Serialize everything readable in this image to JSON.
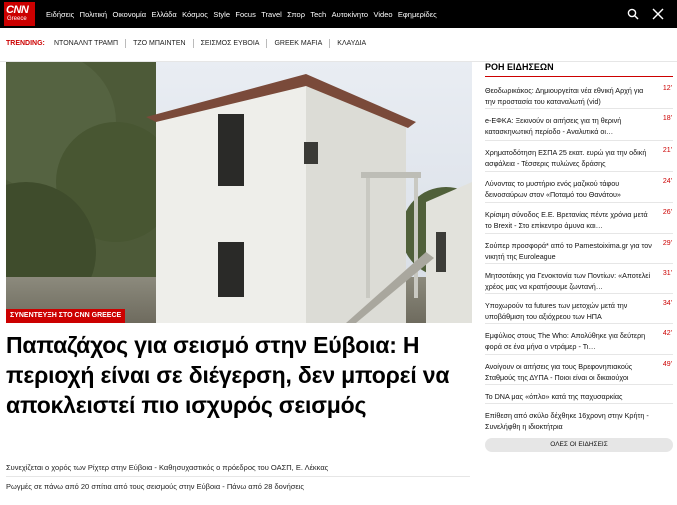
{
  "brand": {
    "logo_main": "CNN",
    "logo_sub": "Greece"
  },
  "nav": {
    "items": [
      "Ειδήσεις",
      "Πολιτική",
      "Οικονομία",
      "Ελλάδα",
      "Κόσμος",
      "Style",
      "Focus",
      "Travel",
      "Σπορ",
      "Tech",
      "Αυτοκίνητο",
      "Video",
      "Εφημερίδες"
    ]
  },
  "icons": {
    "search": "search-icon",
    "menu": "hamburger-menu-icon"
  },
  "trending": {
    "label": "TRENDING:",
    "items": [
      "ΝΤΟΝΑΛΝΤ ΤΡΑΜΠ",
      "ΤΖΟ ΜΠΑΙΝΤΕΝ",
      "ΣΕΙΣΜΟΣ ΕΥΒΟΙΑ",
      "GREEK MAFIA",
      "ΚΛΑΥΔΙΑ"
    ]
  },
  "hero": {
    "tag": "ΣΥΝΕΝΤΕΥΞΗ ΣΤΟ CNN GREECE",
    "headline": "Παπαζάχος για σεισμό στην Εύβοια: Η περιοχή είναι σε διέγερση, δεν μπορεί να αποκλειστεί πιο ισχυρός σεισμός",
    "related": [
      "Συνεχίζεται ο χορός των Ρίχτερ στην Εύβοια - Καθησυχαστικός ο πρόεδρος του ΟΑΣΠ, Ε. Λέκκας",
      "Ρωγμές σε πάνω από 20 σπίτια από τους σεισμούς στην Εύβοια - Πάνω από 28 δονήσεις"
    ]
  },
  "sidebar": {
    "title": "ΡΟΗ ΕΙΔΗΣΕΩΝ",
    "items": [
      {
        "text": "Θεοδωρικάκος: Δημιουργείται νέα εθνική Αρχή για την προστασία του καταναλωτή (vid)",
        "time": "12'"
      },
      {
        "text": "e-ΕΦΚΑ: Ξεκινούν οι αιτήσεις για τη θερινή κατασκηνωτική περίοδο - Αναλυτικά οι…",
        "time": "18'"
      },
      {
        "text": "Χρηματοδότηση ΕΣΠΑ 25 εκατ. ευρώ για την οδική ασφάλεια - Τέσσερις πυλώνες δράσης",
        "time": "21'"
      },
      {
        "text": "Λύνοντας το μυστήριο ενός μαζικού τάφου δεινοσαύρων στον «Ποταμό του Θανάτου»",
        "time": "24'"
      },
      {
        "text": "Κρίσιμη σύνοδος Ε.Ε. Βρετανίας πέντε χρόνια μετά το Brexit - Στο επίκεντρο άμυνα και…",
        "time": "26'"
      },
      {
        "text": "Σούπερ προσφορά* από το Pamestoixima.gr για τον νικητή της Euroleague",
        "time": "29'"
      },
      {
        "text": "Μητσοτάκης για Γενοκτονία των Ποντίων: «Αποτελεί χρέος μας να κρατήσουμε ζωντανή…",
        "time": "31'"
      },
      {
        "text": "Υποχωρούν τα futures των μετοχών μετά την υποβάθμιση του αξιόχρεου των ΗΠΑ",
        "time": "34'"
      },
      {
        "text": "Εμφύλιος στους The Who: Απολύθηκε για δεύτερη φορά σε ένα μήνα ο ντράμερ - Τι…",
        "time": "42'"
      },
      {
        "text": "Ανοίγουν οι αιτήσεις για τους Βρεφονηπιακούς Σταθμούς της ΔΥΠΑ - Ποιοι είναι οι δικαιούχοι",
        "time": "49'"
      },
      {
        "text": "Το DNA μας «όπλο» κατά της παχυσαρκίας",
        "time": ""
      },
      {
        "text": "Επίθεση από σκύλο δέχθηκε 16χρονη στην Κρήτη - Συνελήφθη η ιδιοκτήτρια",
        "time": ""
      }
    ],
    "more_button": "ΟΛΕΣ ΟΙ ΕΙΔΗΣΕΙΣ"
  },
  "colors": {
    "brand_red": "#cc0000",
    "nav_bg": "#000000"
  }
}
